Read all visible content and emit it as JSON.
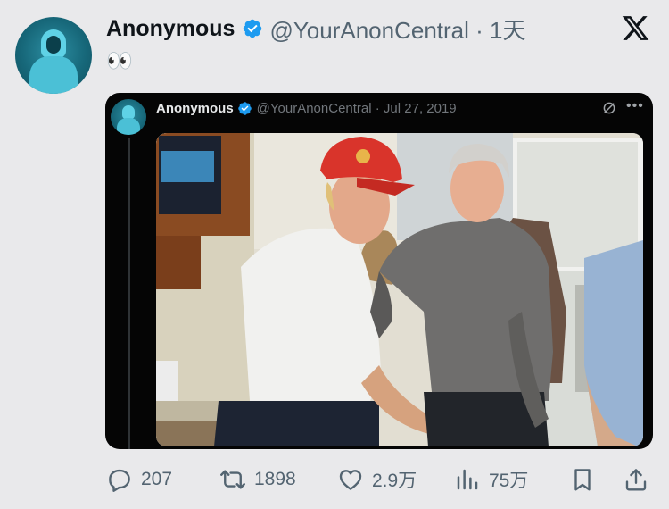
{
  "tweet": {
    "author_name": "Anonymous",
    "handle_time": "@YourAnonCentral · 1天",
    "text": "👀"
  },
  "quoted": {
    "author_name": "Anonymous",
    "handle_date": "@YourAnonCentral · Jul 27, 2019"
  },
  "actions": {
    "replies": "207",
    "reposts": "1898",
    "likes": "2.9万",
    "views": "75万"
  },
  "icons": [
    "x-logo-icon",
    "verified-badge-icon",
    "grok-icon",
    "more-icon",
    "reply-icon",
    "repost-icon",
    "like-icon",
    "views-icon",
    "bookmark-icon",
    "share-icon"
  ],
  "colors": {
    "verified": "#1d9bf0",
    "quote_background": "#050505",
    "page_background": "#e9e9eb"
  }
}
